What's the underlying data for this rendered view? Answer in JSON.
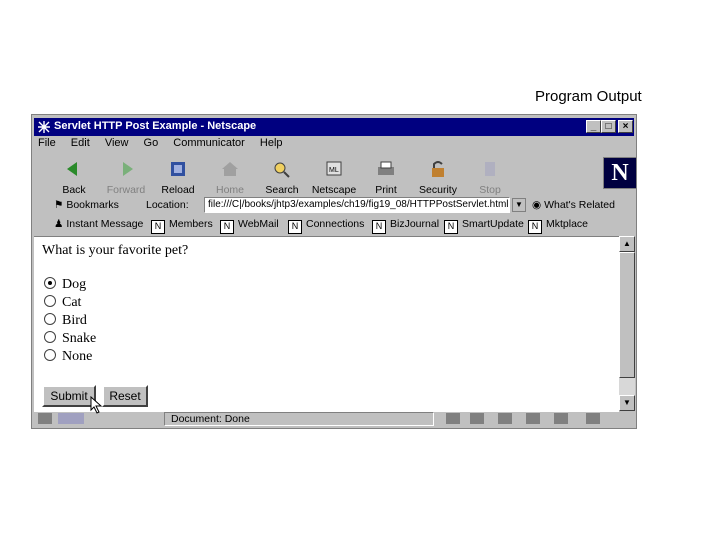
{
  "caption": "Program Output",
  "window": {
    "title": "Servlet HTTP Post Example - Netscape",
    "controls": [
      "_",
      "□",
      "×"
    ]
  },
  "menu": [
    "File",
    "Edit",
    "View",
    "Go",
    "Communicator",
    "Help"
  ],
  "toolbar": [
    {
      "label": "Back",
      "icon": "back-icon",
      "enabled": true
    },
    {
      "label": "Forward",
      "icon": "forward-icon",
      "enabled": false
    },
    {
      "label": "Reload",
      "icon": "reload-icon",
      "enabled": true
    },
    {
      "label": "Home",
      "icon": "home-icon",
      "enabled": false
    },
    {
      "label": "Search",
      "icon": "search-icon",
      "enabled": true
    },
    {
      "label": "Netscape",
      "icon": "netscape-icon",
      "enabled": true
    },
    {
      "label": "Print",
      "icon": "print-icon",
      "enabled": true
    },
    {
      "label": "Security",
      "icon": "security-icon",
      "enabled": true
    },
    {
      "label": "Stop",
      "icon": "stop-icon",
      "enabled": false
    }
  ],
  "location": {
    "bookmarks_label": "Bookmarks",
    "location_label": "Location:",
    "url": "file:///C|/books/jhtp3/examples/ch19/fig19_08/HTTPPostServlet.html",
    "whats_related": "What's Related"
  },
  "personal": [
    "Instant Message",
    "Members",
    "WebMail",
    "Connections",
    "BizJournal",
    "SmartUpdate",
    "Mktplace"
  ],
  "content": {
    "question": "What is your favorite pet?",
    "options": [
      "Dog",
      "Cat",
      "Bird",
      "Snake",
      "None"
    ],
    "selected": "Dog",
    "submit_label": "Submit",
    "reset_label": "Reset"
  },
  "status": {
    "text": "Document: Done"
  },
  "colors": {
    "titlebar": "#000080",
    "chrome": "#c0c0c0"
  }
}
